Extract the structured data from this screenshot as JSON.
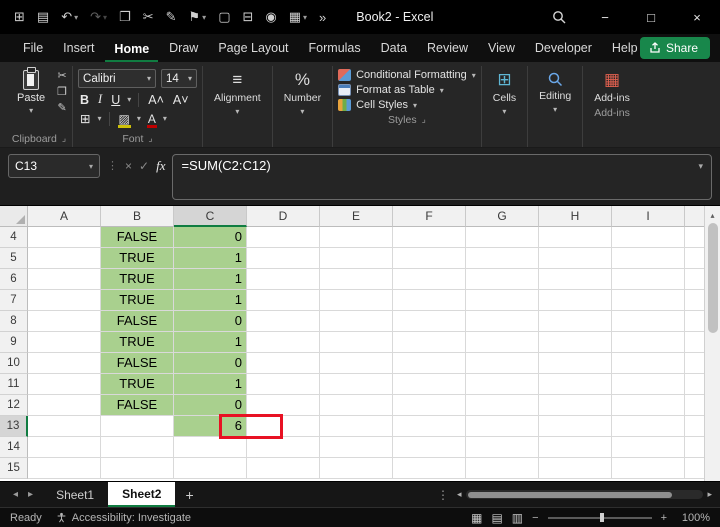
{
  "colors": {
    "accent_green": "#107c41",
    "share_green": "#18874b",
    "cell_fill_green": "#a9d08e",
    "annotation_red": "#e81123",
    "fill_swatch_yellow": "#cdc00a",
    "font_swatch_red": "#c00000"
  },
  "icons": {
    "caret": "▾",
    "dots": "⋮",
    "close_x": "×",
    "check": "✓",
    "minimize": "−",
    "maximize": "□",
    "close": "×",
    "cut": "✂",
    "copy": "❐",
    "format_painter": "✎",
    "borders": "⊞",
    "align_lines": "≡",
    "percent": "%",
    "cells": "⊞",
    "addins": "▦",
    "grow_font": "A˄",
    "shrink_font": "A˅",
    "fill_color": "▨",
    "font_color": "A",
    "nav_left": "◂",
    "nav_right": "▸",
    "scroll_up": "▴",
    "view_normal": "▦",
    "view_layout": "▤",
    "view_break": "▥",
    "zoom_out": "−",
    "zoom_in": "+",
    "overflow": "»"
  },
  "title_bar": {
    "title": "Book2 - Excel",
    "qat": [
      {
        "name": "app-menu",
        "glyph": "⊞"
      },
      {
        "name": "save",
        "glyph": "▤"
      },
      {
        "name": "undo",
        "glyph": "↶",
        "caret": true
      },
      {
        "name": "redo",
        "glyph": "↷",
        "caret": true,
        "disabled": true
      },
      {
        "name": "clipboard",
        "glyph": "❐"
      },
      {
        "name": "cut",
        "glyph": "✂"
      },
      {
        "name": "format-painter",
        "glyph": "✎"
      },
      {
        "name": "flag",
        "glyph": "⚑",
        "caret": true
      },
      {
        "name": "document",
        "glyph": "▢"
      },
      {
        "name": "printer",
        "glyph": "⊟"
      },
      {
        "name": "camera",
        "glyph": "◉"
      },
      {
        "name": "insert-table",
        "glyph": "▦",
        "caret": true
      },
      {
        "name": "qat-overflow",
        "glyph": "»"
      }
    ]
  },
  "menu": {
    "items": [
      "File",
      "Insert",
      "Home",
      "Draw",
      "Page Layout",
      "Formulas",
      "Data",
      "Review",
      "View",
      "Developer",
      "Help"
    ],
    "active": "Home",
    "share_label": "Share"
  },
  "ribbon": {
    "paste": "Paste",
    "clipboard_group": "Clipboard",
    "font_group": "Font",
    "font_name": "Calibri",
    "font_size": "14",
    "bold": "B",
    "italic": "I",
    "underline": "U",
    "alignment": "Alignment",
    "number": "Number",
    "conditional_formatting": "Conditional Formatting",
    "format_as_table": "Format as Table",
    "cell_styles": "Cell Styles",
    "styles_group": "Styles",
    "cells": "Cells",
    "editing": "Editing",
    "addins": "Add-ins",
    "addins_group": "Add-ins"
  },
  "formula_bar": {
    "name_box": "C13",
    "fx": "fx",
    "formula": "=SUM(C2:C12)"
  },
  "grid": {
    "columns": [
      "A",
      "B",
      "C",
      "D",
      "E",
      "F",
      "G",
      "H",
      "I"
    ],
    "selected_column": "C",
    "selected_row": "13",
    "align": {
      "B": "center",
      "C": "right"
    },
    "rows": [
      {
        "num": "4",
        "cells": {
          "B": "FALSE",
          "C": "0"
        },
        "fill": [
          "B",
          "C"
        ]
      },
      {
        "num": "5",
        "cells": {
          "B": "TRUE",
          "C": "1"
        },
        "fill": [
          "B",
          "C"
        ]
      },
      {
        "num": "6",
        "cells": {
          "B": "TRUE",
          "C": "1"
        },
        "fill": [
          "B",
          "C"
        ]
      },
      {
        "num": "7",
        "cells": {
          "B": "TRUE",
          "C": "1"
        },
        "fill": [
          "B",
          "C"
        ]
      },
      {
        "num": "8",
        "cells": {
          "B": "FALSE",
          "C": "0"
        },
        "fill": [
          "B",
          "C"
        ]
      },
      {
        "num": "9",
        "cells": {
          "B": "TRUE",
          "C": "1"
        },
        "fill": [
          "B",
          "C"
        ]
      },
      {
        "num": "10",
        "cells": {
          "B": "FALSE",
          "C": "0"
        },
        "fill": [
          "B",
          "C"
        ]
      },
      {
        "num": "11",
        "cells": {
          "B": "TRUE",
          "C": "1"
        },
        "fill": [
          "B",
          "C"
        ]
      },
      {
        "num": "12",
        "cells": {
          "B": "FALSE",
          "C": "0"
        },
        "fill": [
          "B",
          "C"
        ]
      },
      {
        "num": "13",
        "cells": {
          "C": "6"
        },
        "fill": [
          "C"
        ],
        "active_cell": "C"
      },
      {
        "num": "14",
        "cells": {},
        "fill": []
      },
      {
        "num": "15",
        "cells": {},
        "fill": []
      }
    ]
  },
  "sheet_bar": {
    "tabs": [
      {
        "label": "Sheet1",
        "active": false
      },
      {
        "label": "Sheet2",
        "active": true
      }
    ],
    "add_label": "+"
  },
  "status_bar": {
    "ready": "Ready",
    "accessibility": "Accessibility: Investigate",
    "zoom": "100%"
  }
}
